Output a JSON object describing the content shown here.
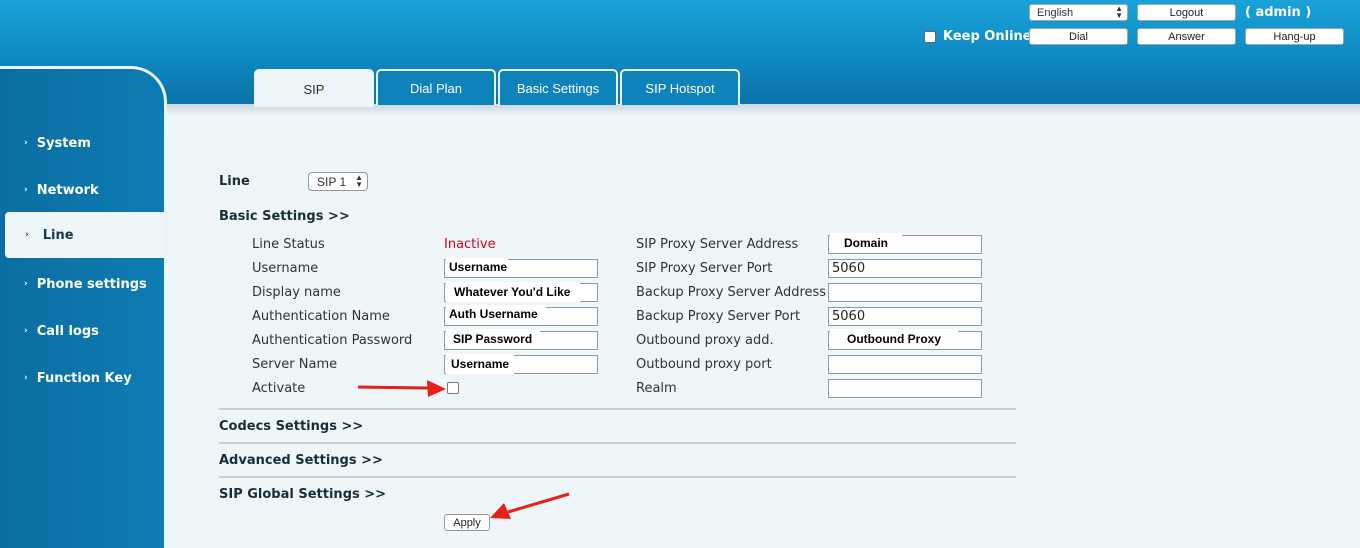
{
  "header": {
    "language": "English",
    "logout_label": "Logout",
    "admin_label": "( admin )",
    "keep_online_label": "Keep Online",
    "dial_label": "Dial",
    "answer_label": "Answer",
    "hangup_label": "Hang-up"
  },
  "sidebar": {
    "items": [
      {
        "label": "System",
        "active": false
      },
      {
        "label": "Network",
        "active": false
      },
      {
        "label": "Line",
        "active": true
      },
      {
        "label": "Phone settings",
        "active": false
      },
      {
        "label": "Call logs",
        "active": false
      },
      {
        "label": "Function Key",
        "active": false
      }
    ]
  },
  "tabs": [
    {
      "label": "SIP",
      "active": true
    },
    {
      "label": "Dial Plan",
      "active": false
    },
    {
      "label": "Basic Settings",
      "active": false
    },
    {
      "label": "SIP Hotspot",
      "active": false
    }
  ],
  "form": {
    "line_label": "Line",
    "line_value": "SIP 1",
    "basic_settings_heading": "Basic Settings >>",
    "left": {
      "line_status_label": "Line Status",
      "line_status_value": "Inactive",
      "username_label": "Username",
      "username_value": "Username",
      "display_name_label": "Display name",
      "display_name_value": "Whatever You'd Like",
      "auth_name_label": "Authentication Name",
      "auth_name_value": "Auth Username",
      "auth_password_label": "Authentication Password",
      "auth_password_value": "SIP Password",
      "server_name_label": "Server Name",
      "server_name_value": "Username",
      "activate_label": "Activate"
    },
    "right": {
      "proxy_address_label": "SIP Proxy Server Address",
      "proxy_address_value": "Domain",
      "proxy_port_label": "SIP Proxy Server Port",
      "proxy_port_value": "5060",
      "backup_address_label": "Backup Proxy Server Address",
      "backup_address_value": "",
      "backup_port_label": "Backup Proxy Server Port",
      "backup_port_value": "5060",
      "outbound_add_label": "Outbound proxy add.",
      "outbound_add_value": "Outbound Proxy",
      "outbound_port_label": "Outbound proxy port",
      "outbound_port_value": "",
      "realm_label": "Realm",
      "realm_value": ""
    },
    "codecs_heading": "Codecs Settings >>",
    "advanced_heading": "Advanced Settings >>",
    "global_heading": "SIP Global Settings >>",
    "apply_label": "Apply"
  },
  "colors": {
    "inactive_status": "#d0021b",
    "arrow": "#e8201a"
  }
}
